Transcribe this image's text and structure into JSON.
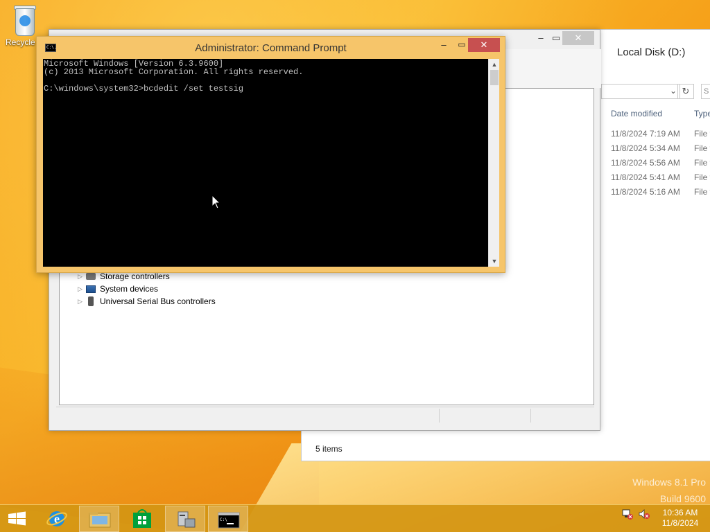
{
  "desktop": {
    "recycle_bin_label": "Recycle",
    "watermark_line1": "Windows 8.1 Pro",
    "watermark_line2": "Build 9600"
  },
  "explorer": {
    "title": "Local Disk (D:)",
    "search_placeholder": "S",
    "columns": {
      "date_modified": "Date modified",
      "type": "Type"
    },
    "rows": [
      {
        "date": "11/8/2024 7:19 AM",
        "type": "File f"
      },
      {
        "date": "11/8/2024 5:34 AM",
        "type": "File f"
      },
      {
        "date": "11/8/2024 5:56 AM",
        "type": "File f"
      },
      {
        "date": "11/8/2024 5:41 AM",
        "type": "File f"
      },
      {
        "date": "11/8/2024 5:16 AM",
        "type": "File f"
      }
    ],
    "status": "5 items"
  },
  "device_manager": {
    "tree": [
      {
        "label": "Storage controllers"
      },
      {
        "label": "System devices"
      },
      {
        "label": "Universal Serial Bus controllers"
      }
    ]
  },
  "cmd": {
    "title": "Administrator: Command Prompt",
    "icon_text": "C:\\.",
    "lines": [
      "Microsoft Windows [Version 6.3.9600]",
      "(c) 2013 Microsoft Corporation. All rights reserved.",
      "",
      "C:\\windows\\system32>bcdedit /set testsig"
    ]
  },
  "taskbar": {
    "items": [
      "start",
      "internet-explorer",
      "file-explorer",
      "store",
      "device-manager",
      "command-prompt"
    ],
    "clock_time": "10:36 AM",
    "clock_date": "11/8/2024"
  },
  "colors": {
    "desktop_accent": "#f7a51e",
    "cmd_frame": "#f6c56a",
    "close_red": "#c75050"
  }
}
